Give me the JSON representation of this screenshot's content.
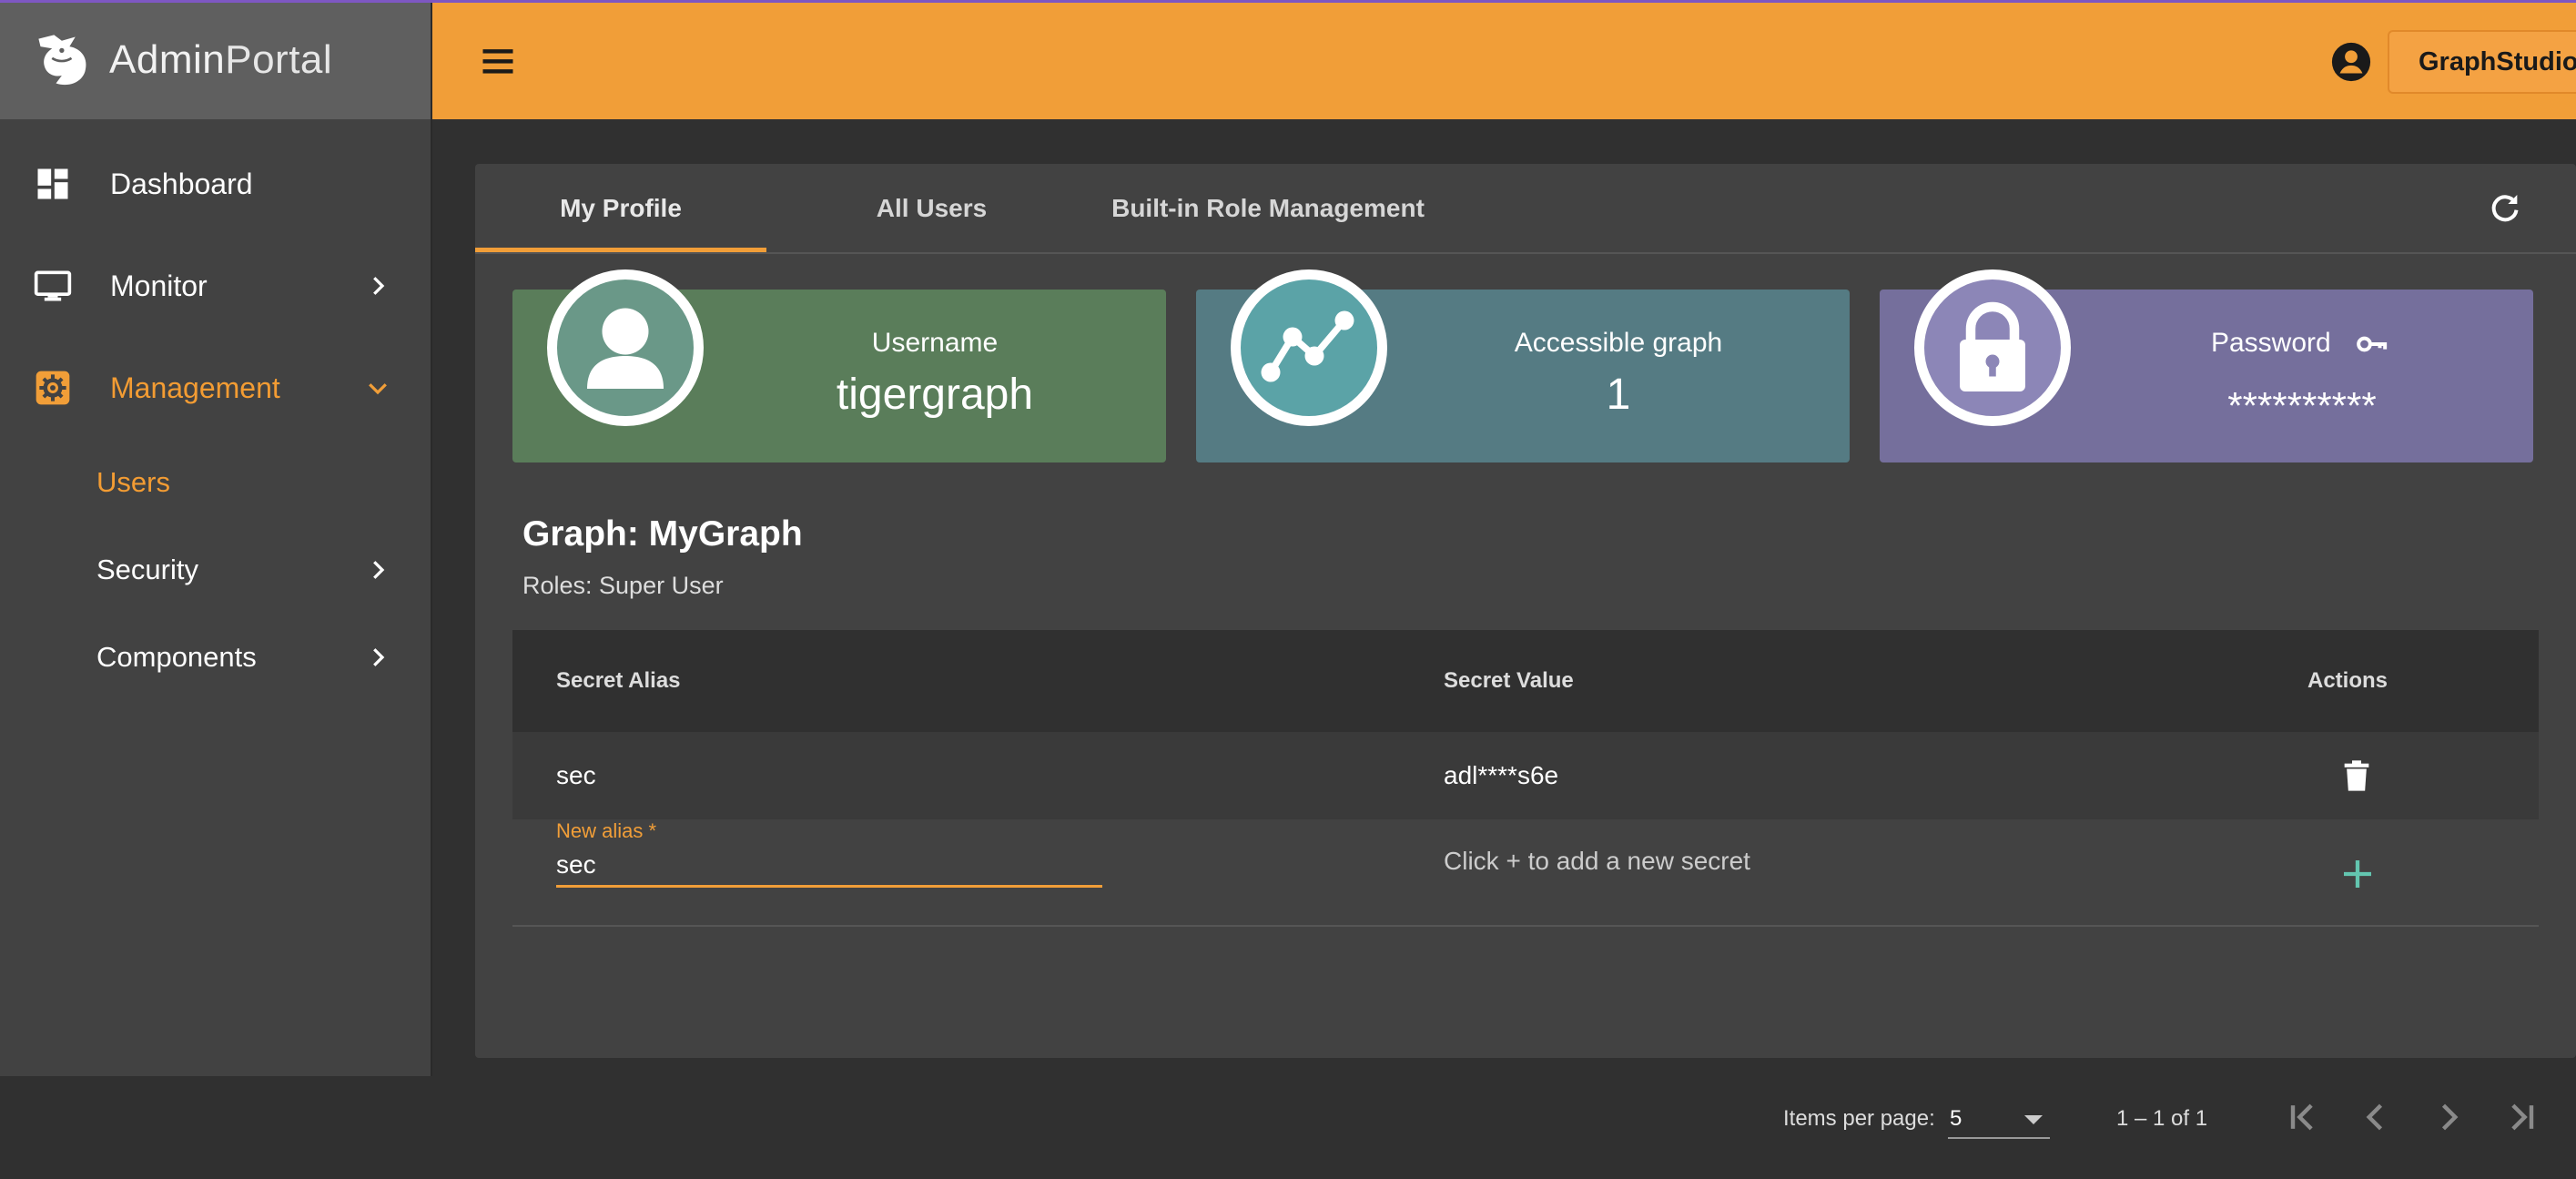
{
  "brand": {
    "name_part1": "Admin",
    "name_part2": "Portal"
  },
  "sidebar": {
    "items": [
      {
        "label": "Dashboard",
        "icon": "dashboard-icon"
      },
      {
        "label": "Monitor",
        "icon": "monitor-icon"
      },
      {
        "label": "Management",
        "icon": "management-icon",
        "active": true
      }
    ],
    "subitems": [
      {
        "label": "Users",
        "active": true
      },
      {
        "label": "Security"
      },
      {
        "label": "Components"
      }
    ]
  },
  "header": {
    "graphstudio_label": "GraphStudio"
  },
  "tabs": [
    {
      "label": "My Profile",
      "active": true
    },
    {
      "label": "All Users"
    },
    {
      "label": "Built-in Role Management"
    }
  ],
  "stats": {
    "username": {
      "label": "Username",
      "value": "tigergraph"
    },
    "graph": {
      "label": "Accessible graph",
      "value": "1"
    },
    "password": {
      "label": "Password",
      "value": "**********"
    }
  },
  "graph": {
    "title": "Graph: MyGraph",
    "roles": "Roles: Super User"
  },
  "table": {
    "headers": {
      "alias": "Secret Alias",
      "value": "Secret Value",
      "actions": "Actions"
    },
    "rows": [
      {
        "alias": "sec",
        "value": "adl****s6e"
      }
    ],
    "new_row": {
      "label": "New alias *",
      "value": "sec",
      "hint": "Click + to add a new secret"
    }
  },
  "pager": {
    "items_label": "Items per page:",
    "page_size": "5",
    "range": "1 – 1 of 1"
  },
  "colors": {
    "accent": "#f19e38",
    "username_card": "#5a7d5a",
    "graph_card": "#557b83",
    "password_card": "#756f9c"
  }
}
